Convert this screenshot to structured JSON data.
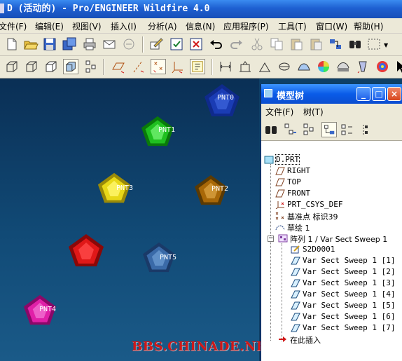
{
  "window": {
    "title": "D (活动的) - Pro/ENGINEER Wildfire 4.0"
  },
  "menu": [
    "文件(F)",
    "编辑(E)",
    "视图(V)",
    "插入(I)",
    "分析(A)",
    "信息(N)",
    "应用程序(P)",
    "工具(T)",
    "窗口(W)",
    "帮助(H)"
  ],
  "colors": {
    "titlebar": "#1e5fd1",
    "viewport": "#114a76",
    "panel_title": "#0a5ce8",
    "watermark": "#d01818"
  },
  "toolbar1": [
    "new-icon",
    "open-icon",
    "save-icon",
    "save-copy-icon",
    "print-icon",
    "send-mail-icon",
    "send-link-icon",
    "regenerate-icon",
    "repaint-icon",
    "close-window-icon",
    "undo-icon",
    "redo-icon",
    "cut-icon",
    "copy-icon",
    "paste-icon",
    "paste-special-icon",
    "relations-icon",
    "find-icon",
    "select-box-icon"
  ],
  "toolbar2": [
    "wireframe-icon",
    "hidden-line-icon",
    "no-hidden-icon",
    "shading-icon",
    "model-tree-icon",
    "datum-planes-icon",
    "datum-axes-icon",
    "datum-points-icon",
    "coord-sys-icon",
    "annotations-icon",
    "refit-icon",
    "zoom-in-icon",
    "zoom-out-icon",
    "reorient-icon",
    "saved-views-icon",
    "layers-icon",
    "appearance-icon",
    "spin-center-icon",
    "model-setup-icon",
    "select-arrow-icon"
  ],
  "viewport": {
    "points": [
      {
        "name": "PNT0",
        "color": "#1a3cb4"
      },
      {
        "name": "PNT1",
        "color": "#20c020"
      },
      {
        "name": "PNT2",
        "color": "#a86808"
      },
      {
        "name": "PNT3",
        "color": "#e8d818"
      },
      {
        "name": "PNT4",
        "color": "#e020a8"
      },
      {
        "name": "PNT5",
        "color": "#3a6aa8"
      }
    ],
    "unlabeled_gem_color": "#e01818",
    "watermark": "BBS.CHINADE.NET"
  },
  "model_tree": {
    "title": "模型树",
    "menu": [
      "文件(F)",
      "树(T)"
    ],
    "tools": [
      "show-icon",
      "settings-icon",
      "columns-icon",
      "list-view-icon",
      "expand-icon",
      "collapse-icon"
    ],
    "items": [
      {
        "label": "D.PRT",
        "icon": "part-icon"
      },
      {
        "label": "RIGHT",
        "icon": "datum-plane-icon"
      },
      {
        "label": "TOP",
        "icon": "datum-plane-icon"
      },
      {
        "label": "FRONT",
        "icon": "datum-plane-icon"
      },
      {
        "label": "PRT_CSYS_DEF",
        "icon": "csys-icon"
      },
      {
        "label": "基准点 标识39",
        "icon": "datum-point-icon"
      },
      {
        "label": "草绘 1",
        "icon": "sketch-icon"
      },
      {
        "label": "阵列 1 / Var Sect Sweep 1",
        "icon": "pattern-icon"
      },
      {
        "label": "S2D0001",
        "icon": "sketch-2d-icon"
      },
      {
        "label": "Var Sect Sweep 1 [1]",
        "icon": "sweep-icon"
      },
      {
        "label": "Var Sect Sweep 1 [2]",
        "icon": "sweep-icon"
      },
      {
        "label": "Var Sect Sweep 1 [3]",
        "icon": "sweep-icon"
      },
      {
        "label": "Var Sect Sweep 1 [4]",
        "icon": "sweep-icon"
      },
      {
        "label": "Var Sect Sweep 1 [5]",
        "icon": "sweep-icon"
      },
      {
        "label": "Var Sect Sweep 1 [6]",
        "icon": "sweep-icon"
      },
      {
        "label": "Var Sect Sweep 1 [7]",
        "icon": "sweep-icon"
      },
      {
        "label": "在此插入",
        "icon": "insert-here-icon"
      }
    ]
  }
}
